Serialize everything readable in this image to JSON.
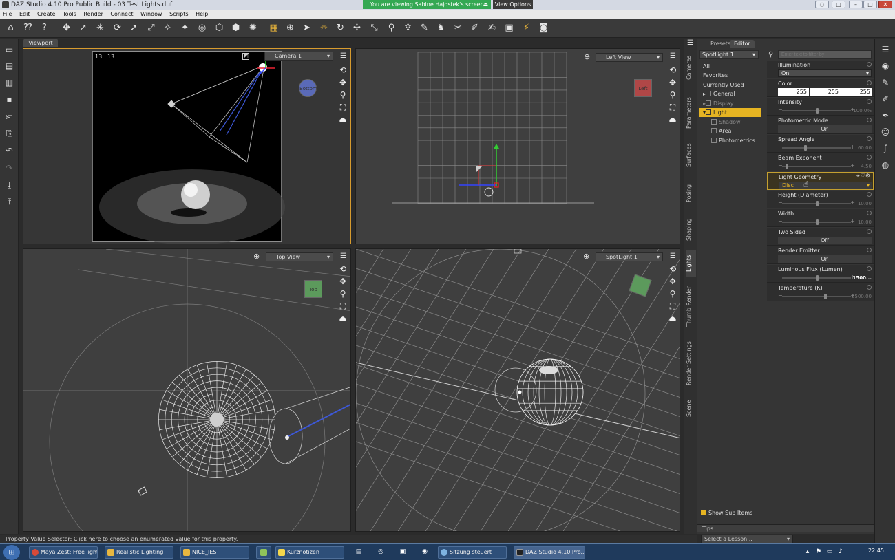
{
  "window": {
    "title": "DAZ Studio 4.10 Pro Public Build - 03 Test Lights.duf",
    "share_banner": "You are viewing Sabine Hajostek's screen",
    "view_options": "View Options"
  },
  "menu": [
    "File",
    "Edit",
    "Create",
    "Tools",
    "Render",
    "Connect",
    "Window",
    "Scripts",
    "Help"
  ],
  "viewport": {
    "tab_label": "Viewport",
    "frame_counter": "13 : 13",
    "views": {
      "camera": "Camera 1",
      "left": "Left View",
      "top": "Top View",
      "spot": "SpotLight 1"
    },
    "cube_labels": {
      "camera": "Bottom",
      "left": "Left",
      "top": "Top"
    }
  },
  "vertical_tabs": [
    "Cameras",
    "Parameters",
    "Surfaces",
    "Posing",
    "Shaping",
    "Lights",
    "Thumb Render",
    "Render Settings",
    "Scene"
  ],
  "pane": {
    "tabs": [
      "Presets",
      "Editor"
    ],
    "active_tab": "Editor",
    "node_selector": "SpotLight 1",
    "filter_placeholder": "Enter text to filter by",
    "tree": [
      {
        "label": "All"
      },
      {
        "label": "Favorites"
      },
      {
        "label": "Currently Used"
      },
      {
        "label": "General"
      },
      {
        "label": "Display"
      },
      {
        "label": "Light"
      },
      {
        "label": "Shadow"
      },
      {
        "label": "Area"
      },
      {
        "label": "Photometrics"
      }
    ],
    "properties": {
      "illumination": {
        "label": "Illumination",
        "value": "On"
      },
      "color": {
        "label": "Color",
        "r": "255",
        "g": "255",
        "b": "255"
      },
      "intensity": {
        "label": "Intensity",
        "value": "100.0%",
        "level": 0.5
      },
      "photometric_mode": {
        "label": "Photometric Mode",
        "value": "On"
      },
      "spread_angle": {
        "label": "Spread Angle",
        "value": "60.00",
        "level": 0.33
      },
      "beam_exponent": {
        "label": "Beam Exponent",
        "value": "4.50",
        "level": 0.05
      },
      "light_geometry": {
        "label": "Light Geometry",
        "value": "Disc"
      },
      "height": {
        "label": "Height (Diameter)",
        "value": "10.00",
        "level": 0.5
      },
      "width": {
        "label": "Width",
        "value": "10.00",
        "level": 0.5
      },
      "two_sided": {
        "label": "Two Sided",
        "value": "Off"
      },
      "render_emitter": {
        "label": "Render Emitter",
        "value": "On"
      },
      "luminous_flux": {
        "label": "Luminous Flux (Lumen)",
        "value": "1500...",
        "level": 0.5
      },
      "temperature": {
        "label": "Temperature (K)",
        "value": "6500.00",
        "level": 0.62
      }
    },
    "show_sub_items": "Show Sub Items",
    "tips": "Tips",
    "lesson": "Select a Lesson..."
  },
  "status": "Property Value Selector: Click here to choose an enumerated value for this property.",
  "taskbar": {
    "items": [
      "Maya Zest: Free light...",
      "Realistic Lighting",
      "NICE_IES",
      "Kurznotizen",
      "Sitzung steuert",
      "DAZ Studio 4.10 Pro..."
    ],
    "clock": "22:45"
  }
}
